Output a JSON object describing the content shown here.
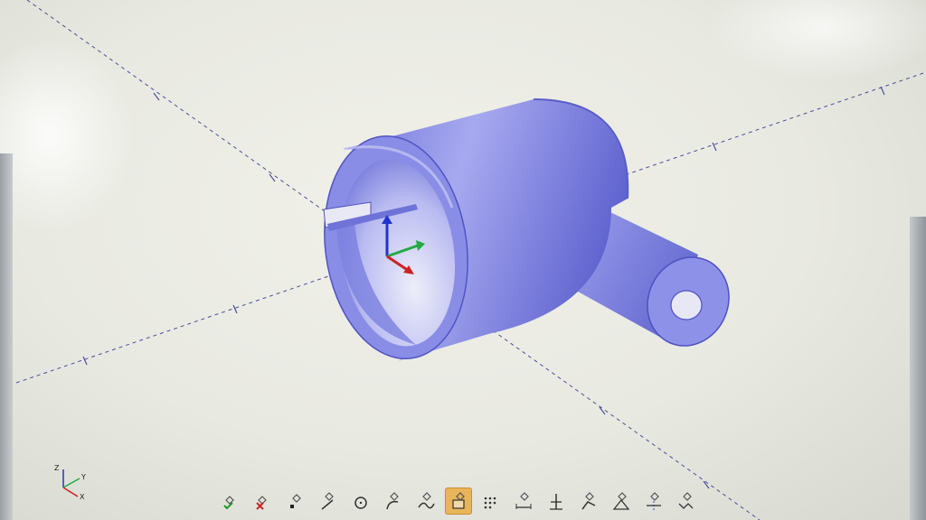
{
  "viewport": {
    "name": "3d-model-viewport",
    "model": "pipe-fitting"
  },
  "triad": {
    "z_label": "Z",
    "y_label": "Y",
    "x_label": "X"
  },
  "toolbar": {
    "active_index": 7,
    "tools": [
      {
        "icon": "apply-check-icon"
      },
      {
        "icon": "cancel-x-icon"
      },
      {
        "icon": "point-icon"
      },
      {
        "icon": "line-icon"
      },
      {
        "icon": "circle-icon"
      },
      {
        "icon": "arc-icon"
      },
      {
        "icon": "spline-icon"
      },
      {
        "icon": "sketch-box-icon"
      },
      {
        "icon": "grid-dots-icon"
      },
      {
        "icon": "dimension-icon"
      },
      {
        "icon": "trim-icon"
      },
      {
        "icon": "extend-icon"
      },
      {
        "icon": "constraint-icon"
      },
      {
        "icon": "mirror-icon"
      },
      {
        "icon": "pattern-icon"
      }
    ]
  },
  "colors": {
    "model_fill": "#7c7fe0",
    "model_dark": "#5b5ecb",
    "model_light": "#a9abf0",
    "axis_line": "#4a4f9a",
    "triad_z": "#2233cc",
    "triad_y": "#22aa44",
    "triad_x": "#cc2222",
    "active_tool": "#e8b55a"
  }
}
